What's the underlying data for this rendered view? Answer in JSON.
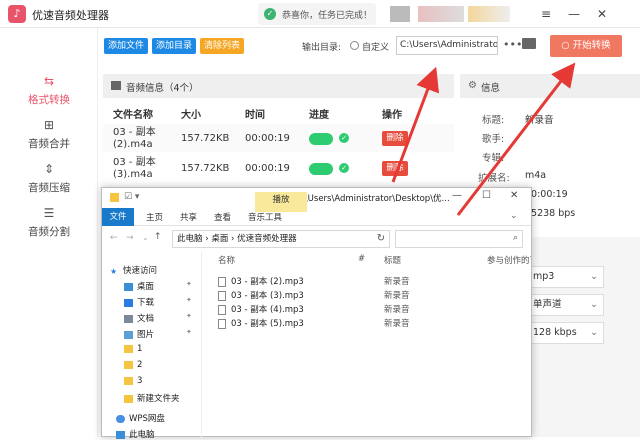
{
  "app": {
    "title": "优速音频处理器",
    "logo_glyph": "♪"
  },
  "toast": {
    "icon": "✓",
    "text": "恭喜你，任务已完成！"
  },
  "window_controls": {
    "menu": "≡",
    "minimize": "—",
    "close": "✕"
  },
  "sidebar": {
    "items": [
      {
        "icon": "convert-icon",
        "glyph": "⇆",
        "label": "格式转换",
        "active": true
      },
      {
        "icon": "merge-icon",
        "glyph": "⊞",
        "label": "音频合并",
        "active": false
      },
      {
        "icon": "compress-icon",
        "glyph": "⇕",
        "label": "音频压缩",
        "active": false
      },
      {
        "icon": "split-icon",
        "glyph": "☰",
        "label": "音频分割",
        "active": false
      }
    ]
  },
  "toolbar": {
    "add_file": "添加文件",
    "add_dir": "添加目录",
    "clear_list": "清除列表",
    "output_label": "输出目录:",
    "custom_label": "自定义",
    "output_path": "C:\\Users\\Administrator\\",
    "more": "•••",
    "start_button": "○ 开始转换"
  },
  "file_panel": {
    "header": "音频信息（4个）",
    "columns": [
      "文件名称",
      "大小",
      "时间",
      "进度",
      "操作"
    ],
    "rows": [
      {
        "name_line1": "03 - 副本",
        "name_line2": "(2).m4a",
        "size": "157.72KB",
        "time": "00:00:19",
        "action": "删除"
      },
      {
        "name_line1": "03 - 副本",
        "name_line2": "(3).m4a",
        "size": "157.72KB",
        "time": "00:00:19",
        "action": "删除"
      }
    ]
  },
  "info_panel": {
    "header": "信息",
    "fields": [
      {
        "label": "标题:",
        "value": "新录音"
      },
      {
        "label": "歌手:",
        "value": ""
      },
      {
        "label": "专辑:",
        "value": ""
      },
      {
        "label": "扩展名:",
        "value": "m4a"
      },
      {
        "label": "",
        "value": "00:00:19"
      },
      {
        "label": "",
        "value": "65238 bps"
      }
    ]
  },
  "settings": {
    "format": "mp3",
    "channel": "单声道",
    "bitrate": "128 kbps"
  },
  "explorer": {
    "title_path": "C:\\Users\\Administrator\\Desktop\\优...",
    "ribbon_tabs": [
      "文件",
      "主页",
      "共享",
      "查看",
      "音乐工具"
    ],
    "play_tab": "播放",
    "breadcrumb": [
      "此电脑",
      "桌面",
      "优速音频处理器"
    ],
    "nav_items": [
      {
        "label": "快速访问",
        "icon": "star-icon",
        "pin": false
      },
      {
        "label": "桌面",
        "icon": "desktop-icon",
        "pin": true
      },
      {
        "label": "下载",
        "icon": "download-icon",
        "pin": true
      },
      {
        "label": "文档",
        "icon": "document-icon",
        "pin": true
      },
      {
        "label": "图片",
        "icon": "picture-icon",
        "pin": true
      },
      {
        "label": "1",
        "icon": "folder-icon",
        "pin": false
      },
      {
        "label": "2",
        "icon": "folder-icon",
        "pin": false
      },
      {
        "label": "3",
        "icon": "folder-icon",
        "pin": false
      },
      {
        "label": "新建文件夹",
        "icon": "folder-icon",
        "pin": false
      },
      {
        "label": "WPS网盘",
        "icon": "cloud-icon",
        "pin": false
      },
      {
        "label": "此电脑",
        "icon": "computer-icon",
        "pin": false
      }
    ],
    "columns": [
      "名称",
      "#",
      "标题",
      "参与创作的艺术家"
    ],
    "files": [
      {
        "name": "03 - 副本 (2).mp3",
        "title": "新录音"
      },
      {
        "name": "03 - 副本 (3).mp3",
        "title": "新录音"
      },
      {
        "name": "03 - 副本 (4).mp3",
        "title": "新录音"
      },
      {
        "name": "03 - 副本 (5).mp3",
        "title": "新录音"
      }
    ]
  },
  "colors": {
    "accent": "#e8556b",
    "start_button": "#f07861",
    "add_btn": "#1e88e5",
    "clear_btn": "#f5a623",
    "arrow": "#e53935"
  }
}
